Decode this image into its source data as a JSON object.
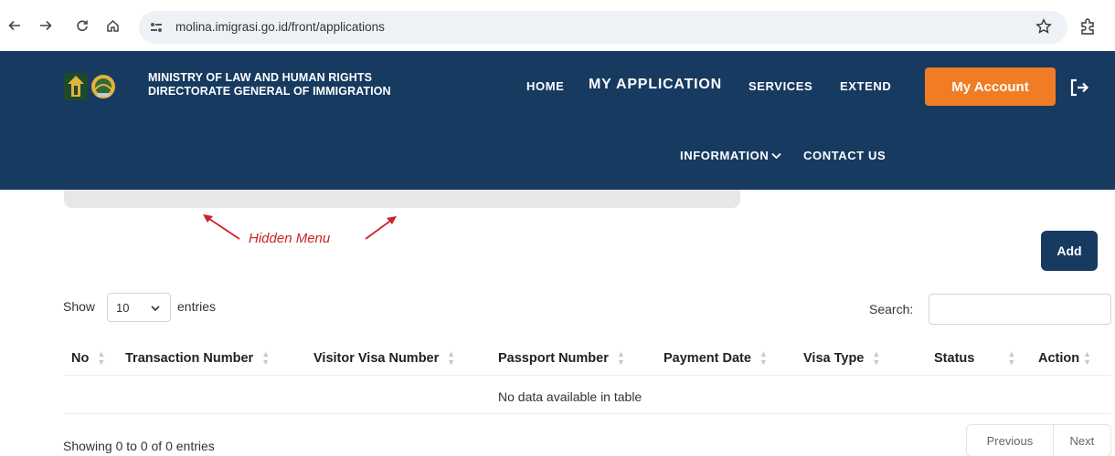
{
  "browser": {
    "url": "molina.imigrasi.go.id/front/applications"
  },
  "header": {
    "org_line1": "MINISTRY OF LAW AND HUMAN RIGHTS",
    "org_line2": "DIRECTORATE GENERAL OF IMMIGRATION",
    "nav": {
      "home": "HOME",
      "my_application": "MY APPLICATION",
      "services": "SERVICES",
      "extend": "EXTEND",
      "information": "INFORMATION",
      "contact": "CONTACT US"
    },
    "account_button": "My Account",
    "brand_color": "#173a60",
    "accent_color": "#f07c25"
  },
  "annotation": {
    "hidden_menu": "Hidden Menu",
    "color": "#cc2229"
  },
  "toolbar": {
    "add_label": "Add"
  },
  "table_controls": {
    "show_label": "Show",
    "entries_value": "10",
    "entries_label": "entries",
    "search_label": "Search:",
    "search_value": ""
  },
  "table": {
    "columns": [
      "No",
      "Transaction Number",
      "Visitor Visa Number",
      "Passport Number",
      "Payment Date",
      "Visa Type",
      "Status",
      "Action"
    ],
    "empty_message": "No data available in table"
  },
  "footer": {
    "showing_text": "Showing 0 to 0 of 0 entries",
    "previous": "Previous",
    "next": "Next"
  }
}
